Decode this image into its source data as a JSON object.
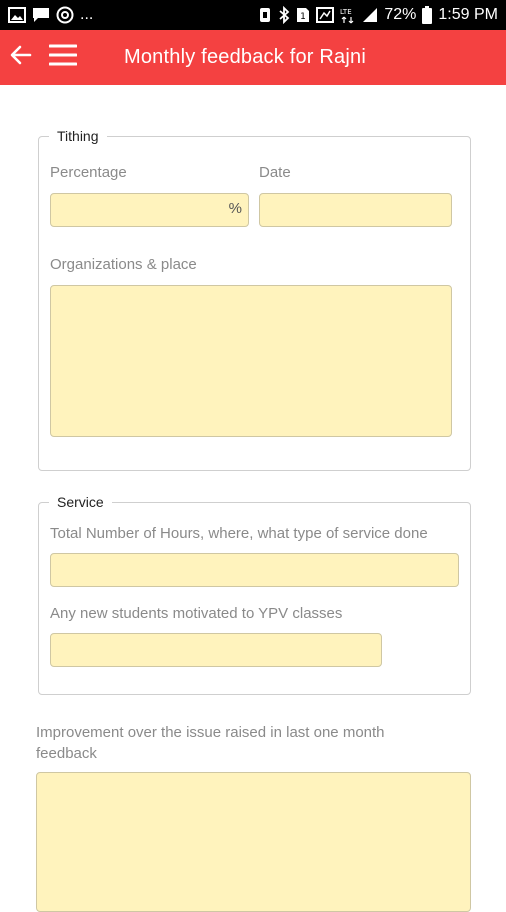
{
  "status_bar": {
    "left_icons": [
      "image-icon",
      "message-icon",
      "at-icon"
    ],
    "ellipsis": "...",
    "right_icons": [
      "vibrate-icon",
      "bluetooth-icon",
      "sim-icon",
      "nfc-icon",
      "lte-icon",
      "signal-icon"
    ],
    "battery_percent": "72%",
    "time": "1:59 PM"
  },
  "app_bar": {
    "title": "Monthly feedback for Rajni",
    "background": "#f44141"
  },
  "tithing": {
    "legend": "Tithing",
    "percentage_label": "Percentage",
    "percentage_value": "",
    "percentage_unit": "%",
    "date_label": "Date",
    "date_value": "",
    "organizations_label": "Organizations & place",
    "organizations_value": ""
  },
  "service": {
    "legend": "Service",
    "hours_label": "Total Number of Hours, where, what type of service done",
    "hours_value": "",
    "students_label": "Any new students motivated to YPV classes",
    "students_value": ""
  },
  "improvement": {
    "label": "Improvement over the issue raised in last one month feedback",
    "value": ""
  },
  "colors": {
    "input_fill": "#fff3bd",
    "accent": "#f44141"
  }
}
